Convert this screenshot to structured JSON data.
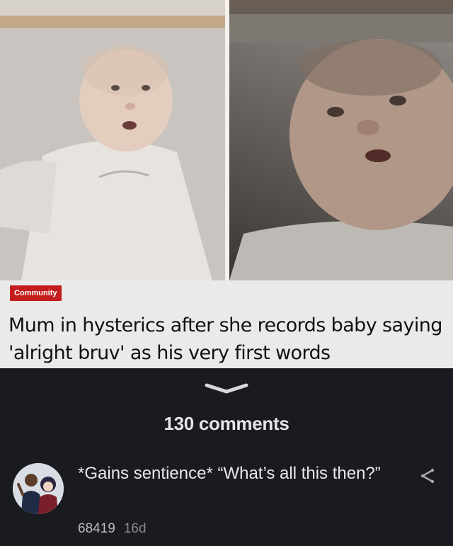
{
  "article": {
    "tag": "Community",
    "headline": "Mum in hysterics after she records baby saying 'alright bruv' as his very first words"
  },
  "comments_section": {
    "count_label": "130 comments",
    "expand_icon": "chevron-down-icon"
  },
  "comment": {
    "text": "*Gains sentience* “What’s all this then?”",
    "score": "68419",
    "age": "16d",
    "avatar_icon": "user-avatar",
    "share_icon": "share-icon"
  },
  "colors": {
    "background": "#1a1b20",
    "tag": "#c31d1d",
    "primary_text": "#e6e6e6",
    "meta_text": "#9a9a9a"
  }
}
